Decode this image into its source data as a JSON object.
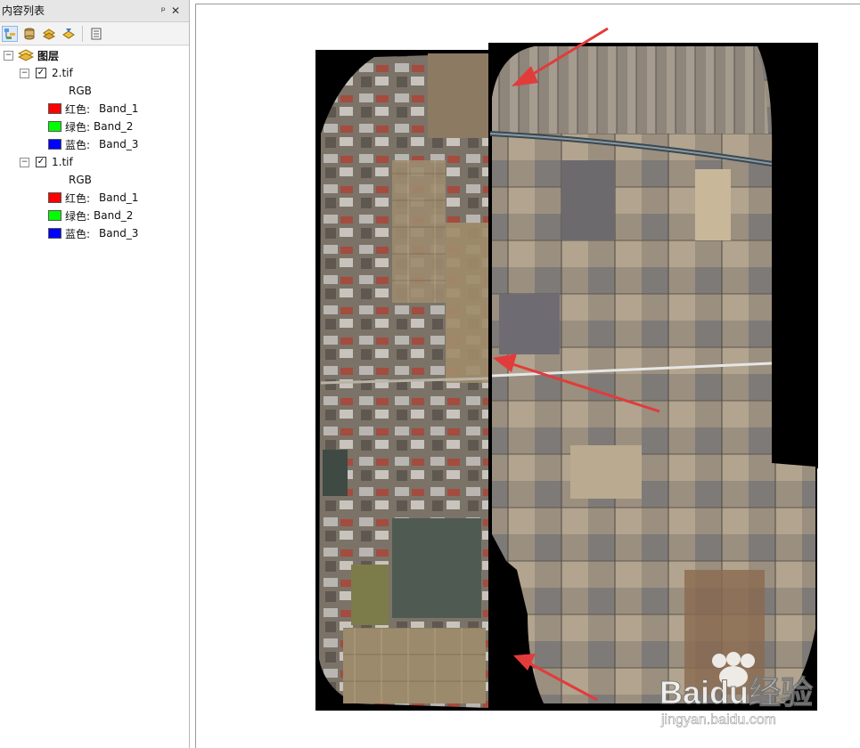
{
  "toc": {
    "title": "内容列表",
    "title_actions": "ᵖ ✕",
    "root_label": "图层",
    "layers": [
      {
        "name": "2.tif",
        "renderer": "RGB",
        "bands": [
          {
            "label": "红色:",
            "band": "Band_1",
            "color": "#ff0000"
          },
          {
            "label": "绿色:",
            "band": "Band_2",
            "color": "#00ff00"
          },
          {
            "label": "蓝色:",
            "band": "Band_3",
            "color": "#0000ff"
          }
        ]
      },
      {
        "name": "1.tif",
        "renderer": "RGB",
        "bands": [
          {
            "label": "红色:",
            "band": "Band_1",
            "color": "#ff0000"
          },
          {
            "label": "绿色:",
            "band": "Band_2",
            "color": "#00ff00"
          },
          {
            "label": "蓝色:",
            "band": "Band_3",
            "color": "#0000ff"
          }
        ]
      }
    ]
  },
  "watermark": {
    "brand": "Baidu经验",
    "url": "jingyan.baidu.com"
  },
  "colors": {
    "arrow": "#e23b3b",
    "nodata": "#000000"
  }
}
